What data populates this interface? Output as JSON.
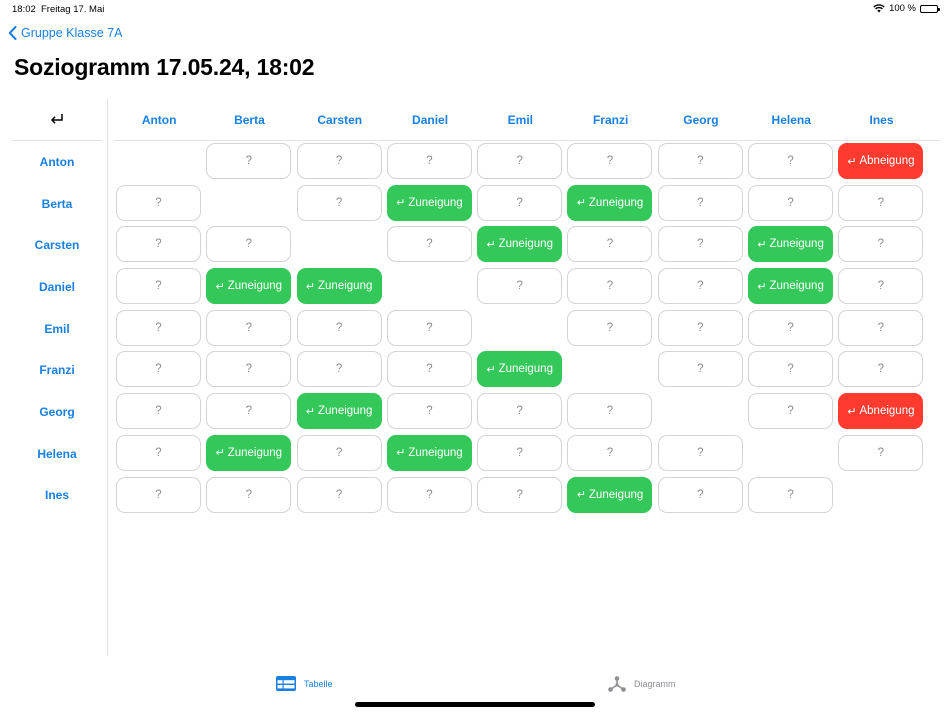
{
  "status": {
    "time": "18:02",
    "date": "Freitag 17. Mai",
    "battery": "100 %"
  },
  "nav": {
    "back_label": "Gruppe Klasse 7A"
  },
  "title": "Soziogramm 17.05.24, 18:02",
  "students": [
    "Anton",
    "Berta",
    "Carsten",
    "Daniel",
    "Emil",
    "Franzi",
    "Georg",
    "Helena",
    "Ines"
  ],
  "labels": {
    "unknown": "?",
    "zuneigung": "Zuneigung",
    "abneigung": "Abneigung",
    "arrow": "↵"
  },
  "colors": {
    "accent": "#1a7fe3",
    "zuneigung": "#34c759",
    "abneigung": "#ff3b30"
  },
  "matrix": [
    [
      null,
      "?",
      "?",
      "?",
      "?",
      "?",
      "?",
      "?",
      "A"
    ],
    [
      "?",
      null,
      "?",
      "Z",
      "?",
      "Z",
      "?",
      "?",
      "?"
    ],
    [
      "?",
      "?",
      null,
      "?",
      "Z",
      "?",
      "?",
      "Z",
      "?"
    ],
    [
      "?",
      "Z",
      "Z",
      null,
      "?",
      "?",
      "?",
      "Z",
      "?"
    ],
    [
      "?",
      "?",
      "?",
      "?",
      null,
      "?",
      "?",
      "?",
      "?"
    ],
    [
      "?",
      "?",
      "?",
      "?",
      "Z",
      null,
      "?",
      "?",
      "?"
    ],
    [
      "?",
      "?",
      "Z",
      "?",
      "?",
      "?",
      null,
      "?",
      "A"
    ],
    [
      "?",
      "Z",
      "?",
      "Z",
      "?",
      "?",
      "?",
      null,
      "?"
    ],
    [
      "?",
      "?",
      "?",
      "?",
      "?",
      "Z",
      "?",
      "?",
      null
    ]
  ],
  "tabs": {
    "tabelle": "Tabelle",
    "diagramm": "Diagramm"
  }
}
